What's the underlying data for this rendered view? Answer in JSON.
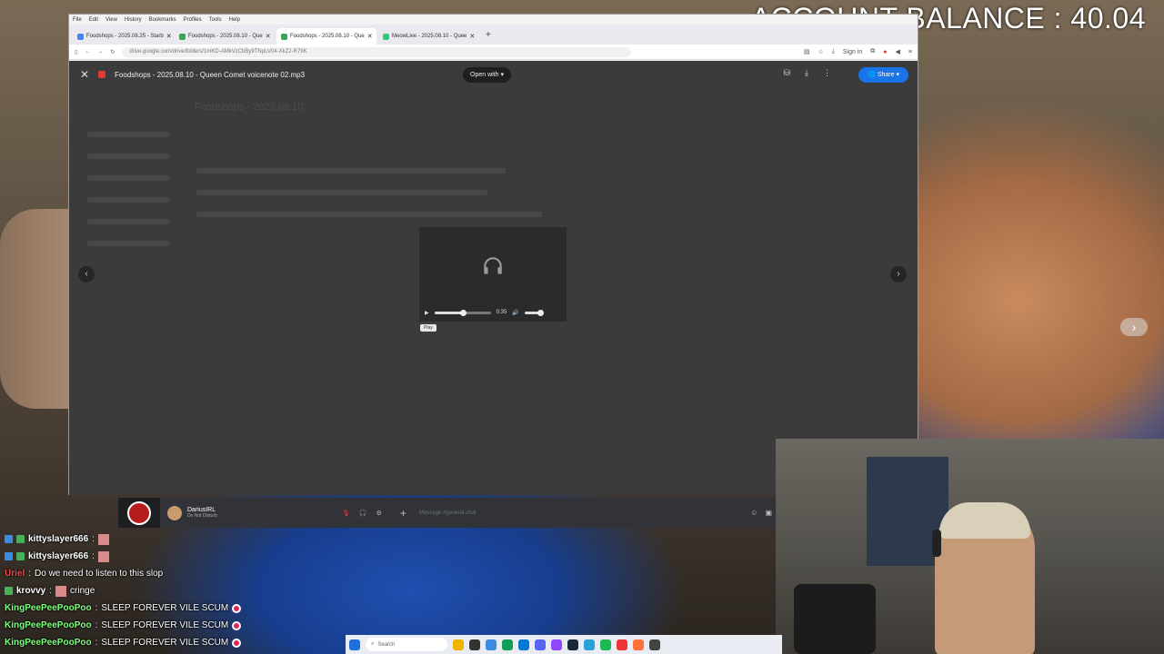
{
  "overlay": {
    "balance": "ACCOUNT BALANCE : 40.04"
  },
  "browser": {
    "menu": [
      "File",
      "Edit",
      "View",
      "History",
      "Bookmarks",
      "Profiles",
      "Tools",
      "Help"
    ],
    "tabs": [
      {
        "label": "Foodshops - 2025.08.25 - Starb",
        "active": false,
        "color": "#4285f4"
      },
      {
        "label": "Foodshops - 2025.08.10 - Que",
        "active": false,
        "color": "#34a853"
      },
      {
        "label": "Foodshops - 2025.08.10 - Que",
        "active": true,
        "color": "#34a853"
      },
      {
        "label": "MeowLive - 2025.08.10 - Quee",
        "active": false,
        "color": "#2ecc71"
      }
    ],
    "url": "drive.google.com/drive/folders/1mKD-AMkVzCbBy9TNpLV04-XkZ2-R79K",
    "sign_in": "Sign in"
  },
  "viewer": {
    "file_name": "Foodshops - 2025.08.10 - Queen Comet voicenote 02.mp3",
    "open_with": "Open with",
    "share": "Share",
    "ghost_folder_title": "Foodshops - 2025.08.10",
    "player": {
      "time": "0:35",
      "progress_fraction": 0.5,
      "volume_fraction": 1.0,
      "tooltip": "Play"
    }
  },
  "discord": {
    "user": "DariusIRL",
    "status": "Do Not Disturb",
    "message_placeholder": "Message #general-chat"
  },
  "chat": [
    {
      "user": "kittyslayer666",
      "text": "",
      "color": "#ffffff",
      "emote": true,
      "badge": "b"
    },
    {
      "user": "kittyslayer666",
      "text": "",
      "color": "#ffffff",
      "emote": true,
      "badge": "b"
    },
    {
      "user": "Uriel",
      "text": "Do we need to listen to this slop",
      "color": "#ff4444",
      "emote": false,
      "badge": ""
    },
    {
      "user": "krovvy",
      "text": "cringe",
      "color": "#ffffff",
      "emote": true,
      "badge": "g"
    },
    {
      "user": "KingPeePeePooPoo",
      "text": "SLEEP FOREVER VILE SCUM",
      "color": "#7fff7f",
      "emote": false,
      "heart": true,
      "badge": ""
    },
    {
      "user": "KingPeePeePooPoo",
      "text": "SLEEP FOREVER VILE SCUM",
      "color": "#7fff7f",
      "emote": false,
      "heart": true,
      "badge": ""
    },
    {
      "user": "KingPeePeePooPoo",
      "text": "SLEEP FOREVER VILE SCUM",
      "color": "#7fff7f",
      "emote": false,
      "heart": true,
      "badge": ""
    }
  ],
  "taskbar": {
    "search_label": "Search"
  }
}
